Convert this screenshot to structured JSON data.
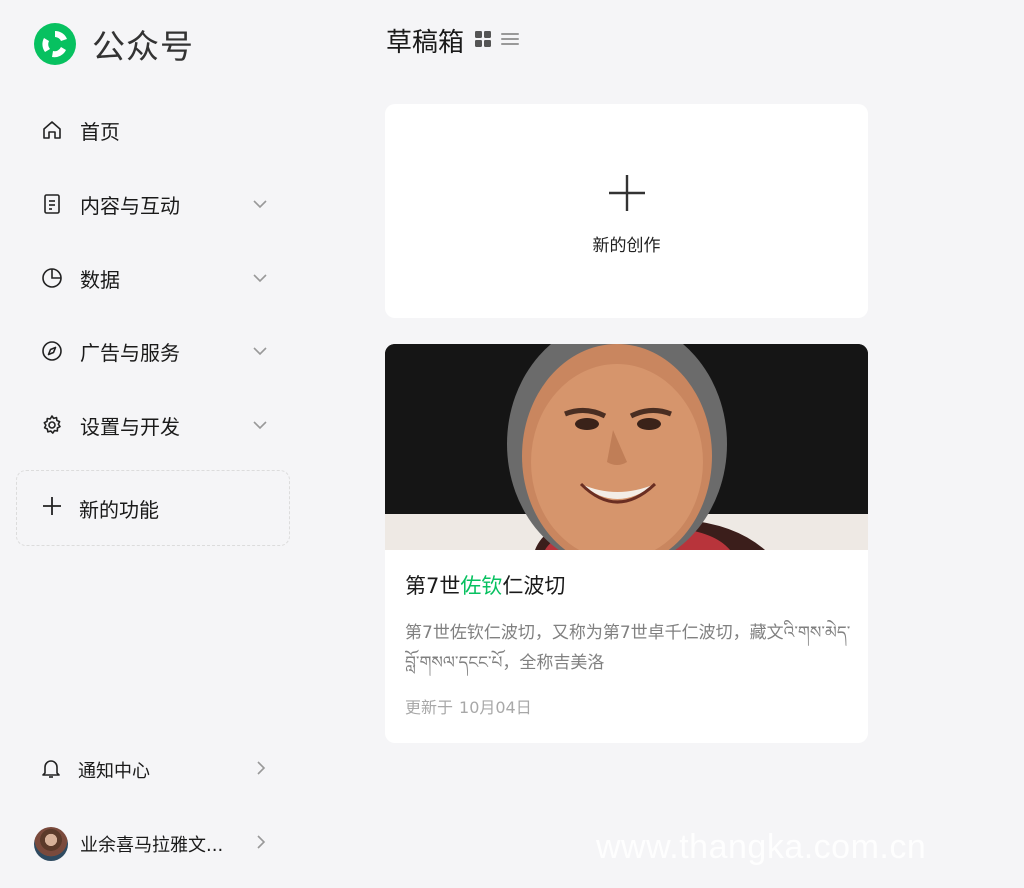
{
  "app": {
    "title": "公众号",
    "brand_color": "#07c160"
  },
  "sidebar": {
    "items": [
      {
        "label": "首页",
        "icon": "home-icon",
        "expandable": false
      },
      {
        "label": "内容与互动",
        "icon": "document-icon",
        "expandable": true
      },
      {
        "label": "数据",
        "icon": "pie-chart-icon",
        "expandable": true
      },
      {
        "label": "广告与服务",
        "icon": "compass-icon",
        "expandable": true
      },
      {
        "label": "设置与开发",
        "icon": "gear-icon",
        "expandable": true
      }
    ],
    "new_feature_label": "新的功能",
    "notification_label": "通知中心",
    "account_label": "业余喜马拉雅文..."
  },
  "main": {
    "title": "草稿箱",
    "view_modes": [
      "grid-view-icon",
      "list-view-icon"
    ],
    "create_card": {
      "label": "新的创作"
    },
    "articles": [
      {
        "title_prefix": "第7世",
        "title_highlight": "佐钦",
        "title_suffix": "仁波切",
        "description": "第7世佐钦仁波切，又称为第7世卓千仁波切，藏文འི་གས་མེད་བློ་གསལ་དངང་པོ，全称吉美洛",
        "date_label": "更新于",
        "date": "10月04日"
      }
    ]
  },
  "watermark": "www.thangka.com.cn"
}
